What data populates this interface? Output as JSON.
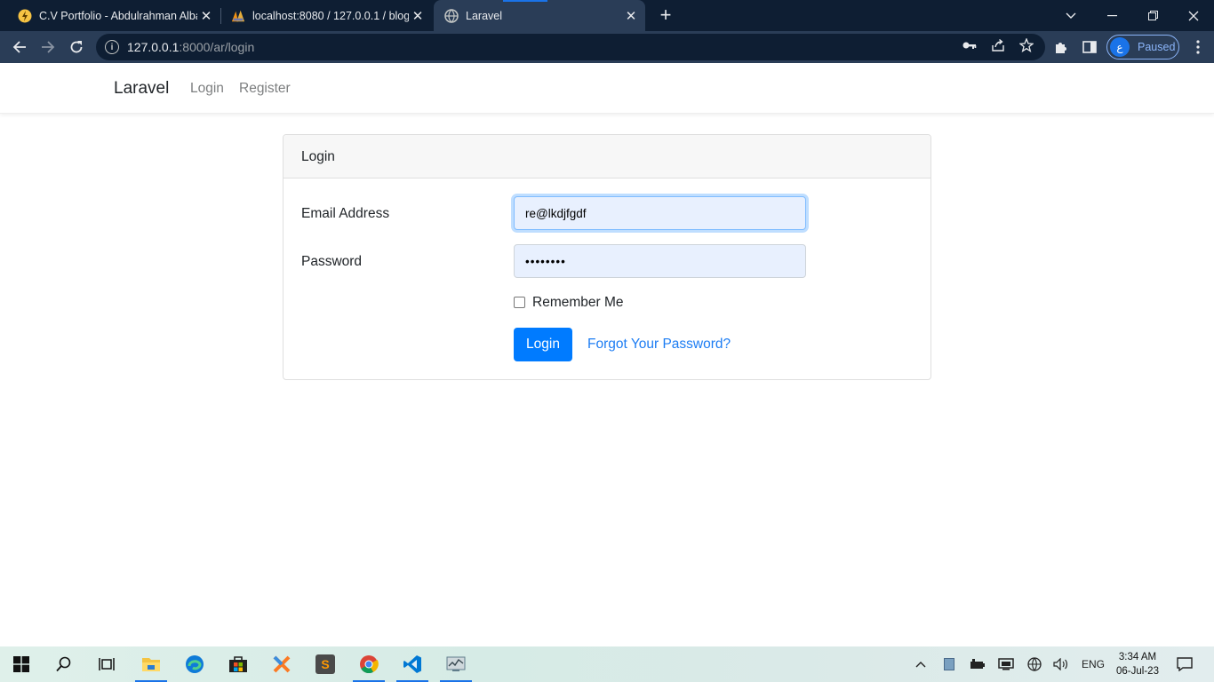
{
  "browser": {
    "tabs": [
      {
        "title": "C.V Portfolio - Abdulrahman Alba",
        "active": false
      },
      {
        "title": "localhost:8080 / 127.0.0.1 / blog",
        "active": false
      },
      {
        "title": "Laravel",
        "active": true
      }
    ],
    "url": {
      "host": "127.0.0.1",
      "path": ":8000/ar/login"
    },
    "profile": {
      "initial": "ع",
      "status": "Paused"
    }
  },
  "app": {
    "brand": "Laravel",
    "nav": {
      "login": "Login",
      "register": "Register"
    }
  },
  "login_card": {
    "header": "Login",
    "email_label": "Email Address",
    "email_value": "re@lkdjfgdf",
    "password_label": "Password",
    "password_value": "••••••••",
    "remember_label": "Remember Me",
    "remember_checked": false,
    "submit_label": "Login",
    "forgot_label": "Forgot Your Password?"
  },
  "taskbar": {
    "lang": "ENG",
    "time": "3:34 AM",
    "date": "06-Jul-23"
  },
  "colors": {
    "tab_strip": "#0e1e33",
    "toolbar": "#2a3d57",
    "primary_button": "#007bff",
    "link": "#1d7df3",
    "autofill_bg": "#e8f0fe"
  }
}
